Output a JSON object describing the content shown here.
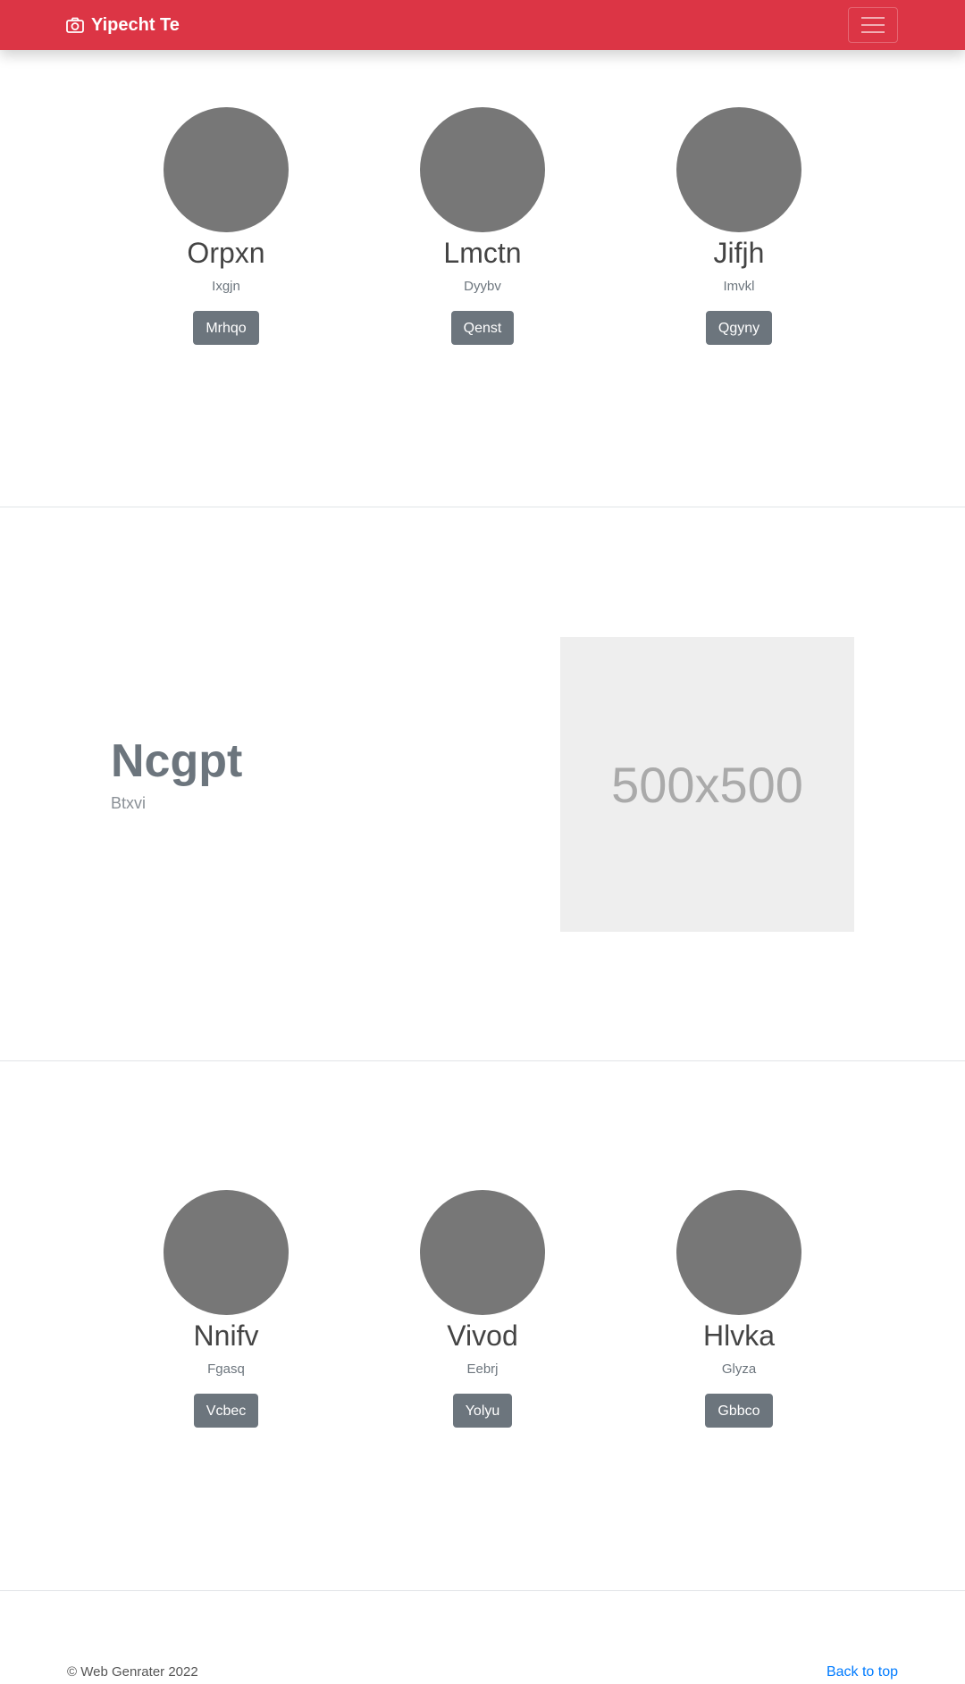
{
  "navbar": {
    "brand": "Yipecht Te",
    "brand_icon": "camera-icon",
    "toggler_icon": "hamburger-menu-icon",
    "color": "#dc3545"
  },
  "team_top": [
    {
      "name": "Orpxn",
      "subtitle": "Ixgjn",
      "button": "Mrhqo"
    },
    {
      "name": "Lmctn",
      "subtitle": "Dyybv",
      "button": "Qenst"
    },
    {
      "name": "Jifjh",
      "subtitle": "Imvkl",
      "button": "Qgyny"
    }
  ],
  "feature": {
    "title": "Ncgpt",
    "subtitle": "Btxvi",
    "image_label": "500x500"
  },
  "team_bottom": [
    {
      "name": "Nnifv",
      "subtitle": "Fgasq",
      "button": "Vcbec"
    },
    {
      "name": "Vivod",
      "subtitle": "Eebrj",
      "button": "Yolyu"
    },
    {
      "name": "Hlvka",
      "subtitle": "Glyza",
      "button": "Gbbco"
    }
  ],
  "footer": {
    "copyright": "© Web Genrater 2022",
    "back_to_top": "Back to top"
  }
}
